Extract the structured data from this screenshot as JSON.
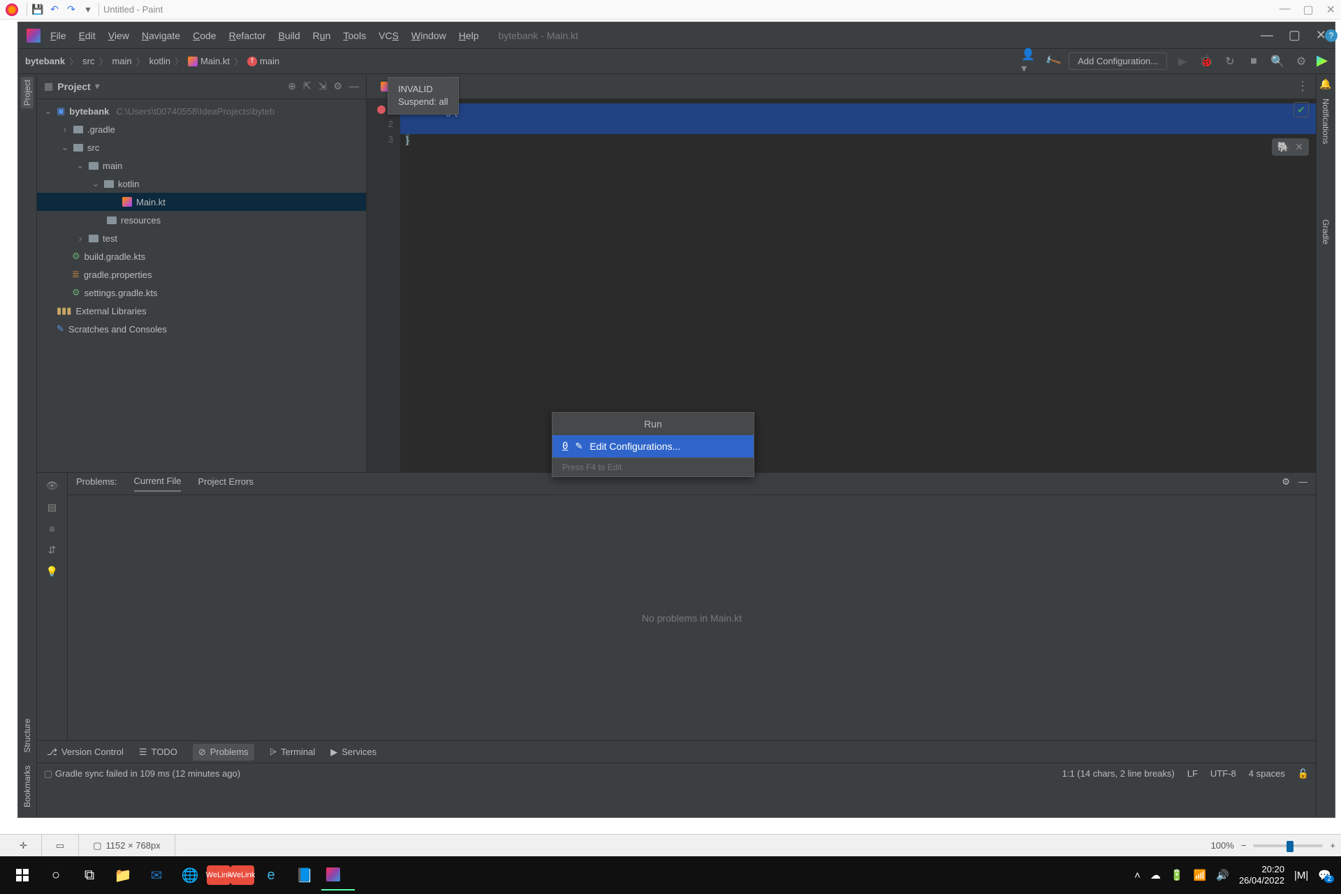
{
  "paint": {
    "title": "Untitled - Paint",
    "canvas_size": "1152 × 768px",
    "zoom": "100%"
  },
  "ide": {
    "title": "bytebank - Main.kt",
    "menu": [
      "File",
      "Edit",
      "View",
      "Navigate",
      "Code",
      "Refactor",
      "Build",
      "Run",
      "Tools",
      "VCS",
      "Window",
      "Help"
    ],
    "breadcrumbs": [
      "bytebank",
      "src",
      "main",
      "kotlin",
      "Main.kt",
      "main"
    ],
    "toolbar": {
      "add_config": "Add Configuration..."
    },
    "project_header": "Project",
    "tree": {
      "root": "bytebank",
      "root_path": "C:\\Users\\t00740558\\IdeaProjects\\byteb",
      "gradle": ".gradle",
      "src": "src",
      "main": "main",
      "kotlin": "kotlin",
      "mainkt": "Main.kt",
      "resources": "resources",
      "test": "test",
      "buildgradle": "build.gradle.kts",
      "gradleprops": "gradle.properties",
      "settings": "settings.gradle.kts",
      "extlib": "External Libraries",
      "scratches": "Scratches and Consoles"
    },
    "editor_tab": "Main.kt",
    "tooltip_l1": "INVALID",
    "tooltip_l2": "Suspend: all",
    "code_line1_tail": "() {",
    "code_line3": "}",
    "run_popup": {
      "title": "Run",
      "key": "0",
      "edit": "Edit Configurations...",
      "hint": "Press F4 to Edit"
    },
    "problems": {
      "label": "Problems:",
      "tab_current": "Current File",
      "tab_project": "Project Errors",
      "empty": "No problems in Main.kt"
    },
    "bottom": {
      "version": "Version Control",
      "todo": "TODO",
      "problems": "Problems",
      "terminal": "Terminal",
      "services": "Services"
    },
    "status": {
      "msg": "Gradle sync failed in 109 ms (12 minutes ago)",
      "pos": "1:1 (14 chars, 2 line breaks)",
      "le": "LF",
      "enc": "UTF-8",
      "indent": "4 spaces"
    },
    "side": {
      "project": "Project",
      "structure": "Structure",
      "bookmarks": "Bookmarks",
      "notifications": "Notifications",
      "gradle": "Gradle"
    }
  },
  "taskbar": {
    "time": "20:20",
    "date": "26/04/2022"
  }
}
